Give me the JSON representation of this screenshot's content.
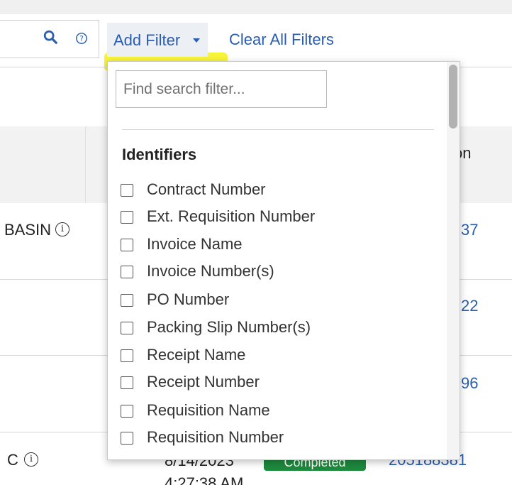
{
  "toolbar": {
    "add_filter_label": "Add Filter",
    "clear_filters_label": "Clear All Filters"
  },
  "filter_dropdown": {
    "search_placeholder": "Find search filter...",
    "section_title": "Identifiers",
    "options": [
      {
        "label": "Contract Number",
        "checked": false
      },
      {
        "label": "Ext. Requisition Number",
        "checked": false
      },
      {
        "label": "Invoice Name",
        "checked": false
      },
      {
        "label": "Invoice Number(s)",
        "checked": false
      },
      {
        "label": "PO Number",
        "checked": false
      },
      {
        "label": "Packing Slip Number(s)",
        "checked": false
      },
      {
        "label": "Receipt Name",
        "checked": false
      },
      {
        "label": "Receipt Number",
        "checked": false
      },
      {
        "label": "Requisition Name",
        "checked": false
      },
      {
        "label": "Requisition Number",
        "checked": false
      }
    ]
  },
  "table_background": {
    "header_partial": "on",
    "row1_text": "BASIN",
    "row1_link": "37",
    "row2_link": "22",
    "row3_link": "96",
    "row4_text": "C",
    "row4_date": "8/14/2023",
    "row4_time": "4:27:38 AM",
    "row4_status": "Completed",
    "row4_link": "205188381"
  },
  "icons": {
    "search": "search-icon",
    "help": "help-icon",
    "caret": "caret-down-icon",
    "info": "info-icon"
  },
  "colors": {
    "link": "#2a5db0",
    "highlight": "#f6f323",
    "status_green": "#1d8a3c"
  }
}
